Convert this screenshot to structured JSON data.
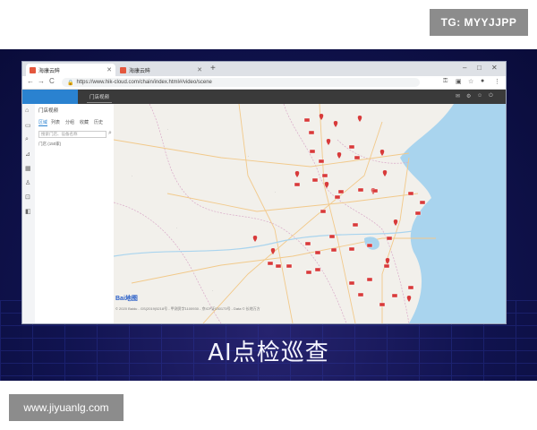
{
  "overlays": {
    "top_right_tag": "TG: MYYJJPP",
    "bottom_left_watermark": "www.jiyuanlg.com"
  },
  "slide": {
    "caption": "AI点检巡查"
  },
  "browser": {
    "tabs": [
      {
        "label": "海康云眸",
        "active": true
      },
      {
        "label": "海康云眸",
        "active": false
      }
    ],
    "new_tab": "+",
    "window_controls": [
      "–",
      "□",
      "✕"
    ],
    "nav": {
      "back": "←",
      "forward": "→",
      "reload": "C"
    },
    "url": "https://www.hik-cloud.com/chain/index.html#/video/scene",
    "toolbar_icons": [
      "key-icon",
      "star-icon",
      "profile-icon",
      "menu-icon"
    ]
  },
  "app": {
    "module_tab": "门店视频",
    "header_icons": [
      "mail-icon",
      "settings-icon",
      "user-icon",
      "logout-icon"
    ],
    "rail_icons": [
      "home-icon",
      "video-icon",
      "search-icon",
      "chart-icon",
      "grid-icon",
      "user-icon",
      "lock-icon",
      "camera-icon"
    ],
    "panel": {
      "title": "门店视频",
      "tabs": [
        "区域",
        "列表",
        "分组",
        "收藏",
        "历史"
      ],
      "active_tab": "区域",
      "search_placeholder": "搜索门店、设备名称",
      "tree_root": "门店  (150家)"
    }
  },
  "map": {
    "provider_logo": "Bai地图",
    "copyright": "© 2020 Baidu - GS(2019)5218号 - 甲测资字1100930 - 京ICP证030173号 - Data © 长地万方",
    "accent": "#d83a3a"
  }
}
